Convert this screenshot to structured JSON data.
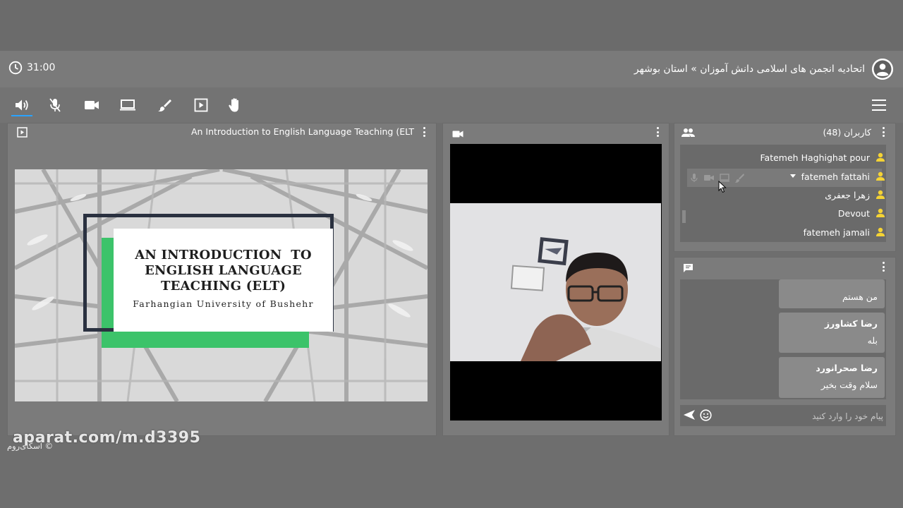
{
  "header": {
    "timer": "31:00",
    "title": "اتحادیه انجمن های اسلامی دانش آموزان » استان بوشهر"
  },
  "toolbar": {
    "buttons": [
      "speaker-icon",
      "mic-muted-icon",
      "camera-icon",
      "screen-share-icon",
      "brush-icon",
      "presentation-icon",
      "raise-hand-icon"
    ],
    "active": "speaker-icon",
    "accent": "#2aa3ff"
  },
  "presentation": {
    "title": "An Introduction to English Language Teaching (ELT",
    "slide": {
      "line1": "AN INTRODUCTION  TO",
      "line2": "ENGLISH LANGUAGE",
      "line3": "TEACHING (ELT)",
      "subtitle": "Farhangian University of Bushehr"
    }
  },
  "users": {
    "title": "کاربران (48)",
    "list": [
      {
        "name": "Fatemeh Haghighat pour"
      },
      {
        "name": "fatemeh fattahi"
      },
      {
        "name": "زهرا جعفری"
      },
      {
        "name": "Devout"
      },
      {
        "name": "fatemeh jamali"
      }
    ],
    "icon_color": "#f5d334"
  },
  "chat": {
    "messages": [
      {
        "name": "",
        "text": "من هستم"
      },
      {
        "name": "رضا کشاورز",
        "text": "بله"
      },
      {
        "name": "رضا صحرانورد",
        "text": "سلام وقت بخیر"
      }
    ],
    "placeholder": "پیام خود را وارد کنید"
  },
  "footer": {
    "watermark": "aparat.com/m.d3395",
    "copyright": "اسکای‌روم ©"
  }
}
